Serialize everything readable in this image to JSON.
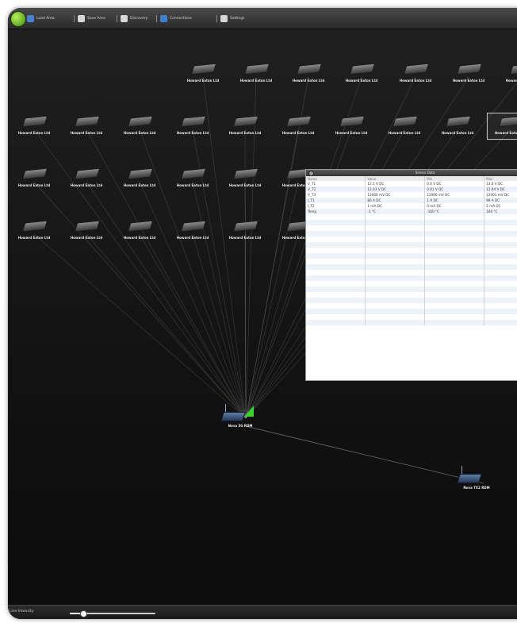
{
  "toolbar": {
    "items": [
      {
        "label": "Load Area",
        "icon": "shield-icon",
        "color": "#4a7fd1"
      },
      {
        "label": "Save Area",
        "icon": "save-icon",
        "color": "#d6d6d6"
      },
      {
        "label": "Discovery",
        "icon": "magnifier-icon",
        "color": "#d6d6d6"
      },
      {
        "label": "Connections",
        "icon": "pen-icon",
        "color": "#3f7fd0"
      },
      {
        "label": "Settings",
        "icon": "settings-icon",
        "color": "#d6d6d6"
      }
    ]
  },
  "devices": {
    "label": "Howard Eaton Ltd",
    "selected_row": 2,
    "selected_col": 9
  },
  "routers": [
    {
      "label": "Nova 5G RDM"
    },
    {
      "label": "Nova TX2 RDM"
    }
  ],
  "sensor_panel": {
    "title": "Sensor Data",
    "columns": [
      "Name",
      "Value",
      "Min",
      "Max"
    ],
    "rows": [
      [
        "V_T1",
        "12.1 V DC",
        "0.0 V DC",
        "13.0 V DC"
      ],
      [
        "V_T2",
        "12.03 V DC",
        "0.01 V DC",
        "12.94 V DC"
      ],
      [
        "V_T3",
        "12000 mV DC",
        "12000 mV DC",
        "12001 mV DC"
      ],
      [
        "I_T1",
        "80 A DC",
        "1 A DC",
        "99 A DC"
      ],
      [
        "I_T2",
        "1 mA DC",
        "0 mA DC",
        "2 mA DC"
      ],
      [
        "Temp",
        "-1 °C",
        "-100 °C",
        "100 °C"
      ]
    ],
    "empty_rows": 20
  },
  "status_bar": {
    "label": "Line Intensity",
    "slider_value": 0.16
  },
  "colors": {
    "signal": "#39d12f",
    "background": "#161616",
    "panel_header": "#3f3f3f"
  }
}
